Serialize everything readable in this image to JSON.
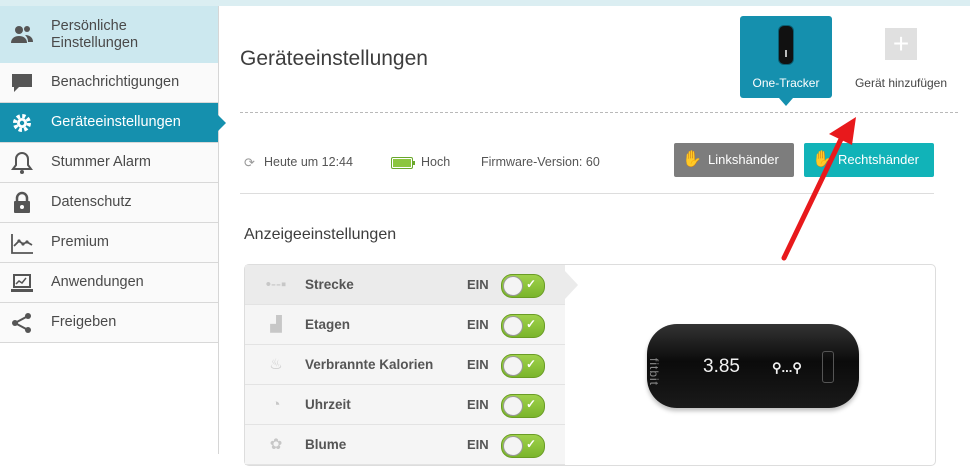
{
  "sidebar": {
    "items": [
      {
        "label": "Persönliche Einstellungen",
        "icon": "users-icon"
      },
      {
        "label": "Benachrichtigungen",
        "icon": "speech-bubble-icon"
      },
      {
        "label": "Geräteeinstellungen",
        "icon": "gear-icon"
      },
      {
        "label": "Stummer Alarm",
        "icon": "bell-icon"
      },
      {
        "label": "Datenschutz",
        "icon": "lock-icon"
      },
      {
        "label": "Premium",
        "icon": "chart-line-icon"
      },
      {
        "label": "Anwendungen",
        "icon": "laptop-icon"
      },
      {
        "label": "Freigeben",
        "icon": "share-icon"
      }
    ],
    "active_index": 2
  },
  "header": {
    "title": "Geräteeinstellungen",
    "device_card_label": "One-Tracker",
    "add_device_label": "Gerät hinzufügen"
  },
  "status": {
    "sync_text": "Heute um 12:44",
    "battery_text": "Hoch",
    "battery_level": 1.0,
    "firmware_text": "Firmware-Version: 60"
  },
  "buttons": {
    "left_hand": "Linkshänder",
    "right_hand": "Rechtshänder"
  },
  "section": {
    "title": "Anzeigeeinstellungen"
  },
  "display_settings": [
    {
      "label": "Strecke",
      "state": "EIN",
      "icon": "distance-icon",
      "on": true
    },
    {
      "label": "Etagen",
      "state": "EIN",
      "icon": "stairs-icon",
      "on": true
    },
    {
      "label": "Verbrannte Kalorien",
      "state": "EIN",
      "icon": "flame-icon",
      "on": true
    },
    {
      "label": "Uhrzeit",
      "state": "EIN",
      "icon": "clock-icon",
      "on": true
    },
    {
      "label": "Blume",
      "state": "EIN",
      "icon": "flower-icon",
      "on": true
    }
  ],
  "device_preview": {
    "brand": "fitbit",
    "value": "3.85"
  },
  "colors": {
    "accent": "#1590ae",
    "right_hand_button": "#11b3b8",
    "left_hand_button": "#7d7d7d",
    "toggle_on": "#8cc63e",
    "annotation_arrow": "#e8191c"
  }
}
